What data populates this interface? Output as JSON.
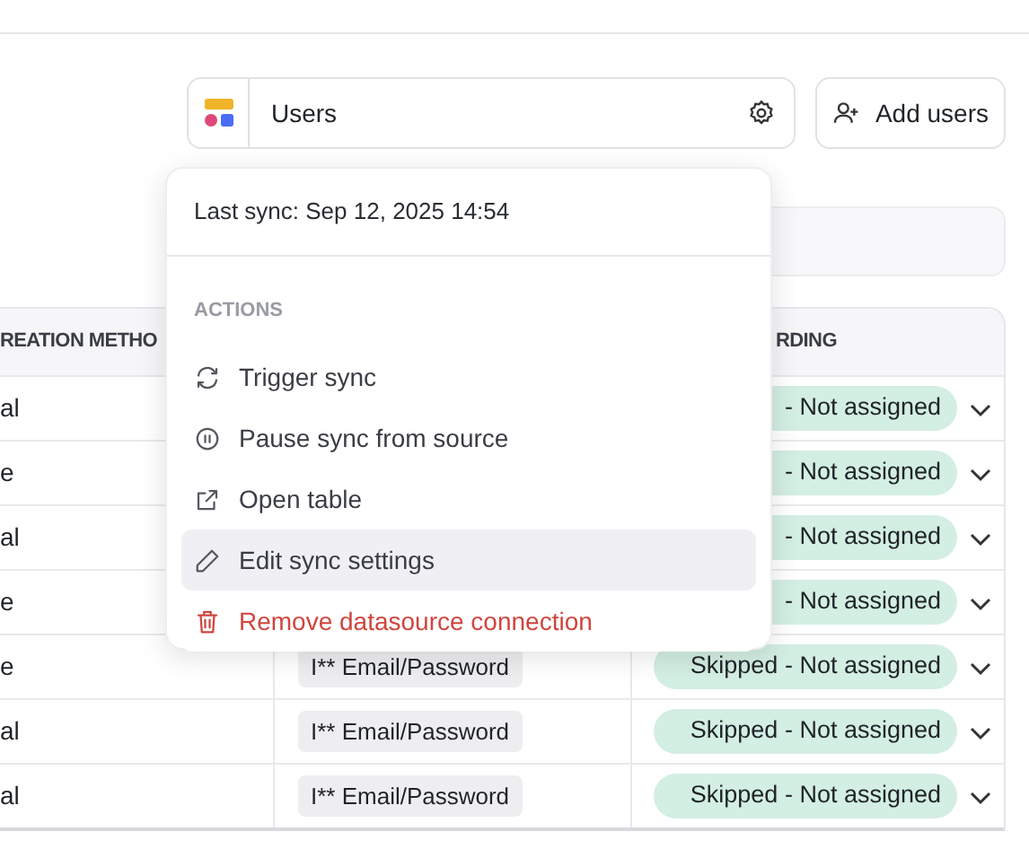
{
  "toolbar": {
    "datasource": {
      "name": "Users"
    },
    "add_button": "Add users"
  },
  "table": {
    "header": {
      "column_1": "REATION METHO",
      "column_3": "RDING"
    },
    "rows": [
      {
        "column_1": "al",
        "column_3": "- Not assigned"
      },
      {
        "column_1": "e",
        "column_3": "- Not assigned"
      },
      {
        "column_1": "al",
        "column_3": "- Not assigned"
      },
      {
        "column_1": "e",
        "column_3": "- Not assigned"
      },
      {
        "column_1": "e",
        "column_2": "I** Email/Password",
        "column_3": "Skipped - Not assigned"
      },
      {
        "column_1": "al",
        "column_2": "I** Email/Password",
        "column_3": "Skipped - Not assigned"
      },
      {
        "column_1": "al",
        "column_2": "I** Email/Password",
        "column_3": "Skipped - Not assigned"
      }
    ]
  },
  "menu": {
    "last_sync": "Last sync: Sep 12, 2025 14:54",
    "section": "ACTIONS",
    "items": [
      {
        "label": "Trigger sync",
        "kind": "normal",
        "selected": false
      },
      {
        "label": "Pause sync from source",
        "kind": "normal",
        "selected": false
      },
      {
        "label": "Open table",
        "kind": "normal",
        "selected": false
      },
      {
        "label": "Edit sync settings",
        "kind": "normal",
        "selected": true
      },
      {
        "label": "Remove datasource connection",
        "kind": "danger",
        "selected": false
      }
    ]
  }
}
